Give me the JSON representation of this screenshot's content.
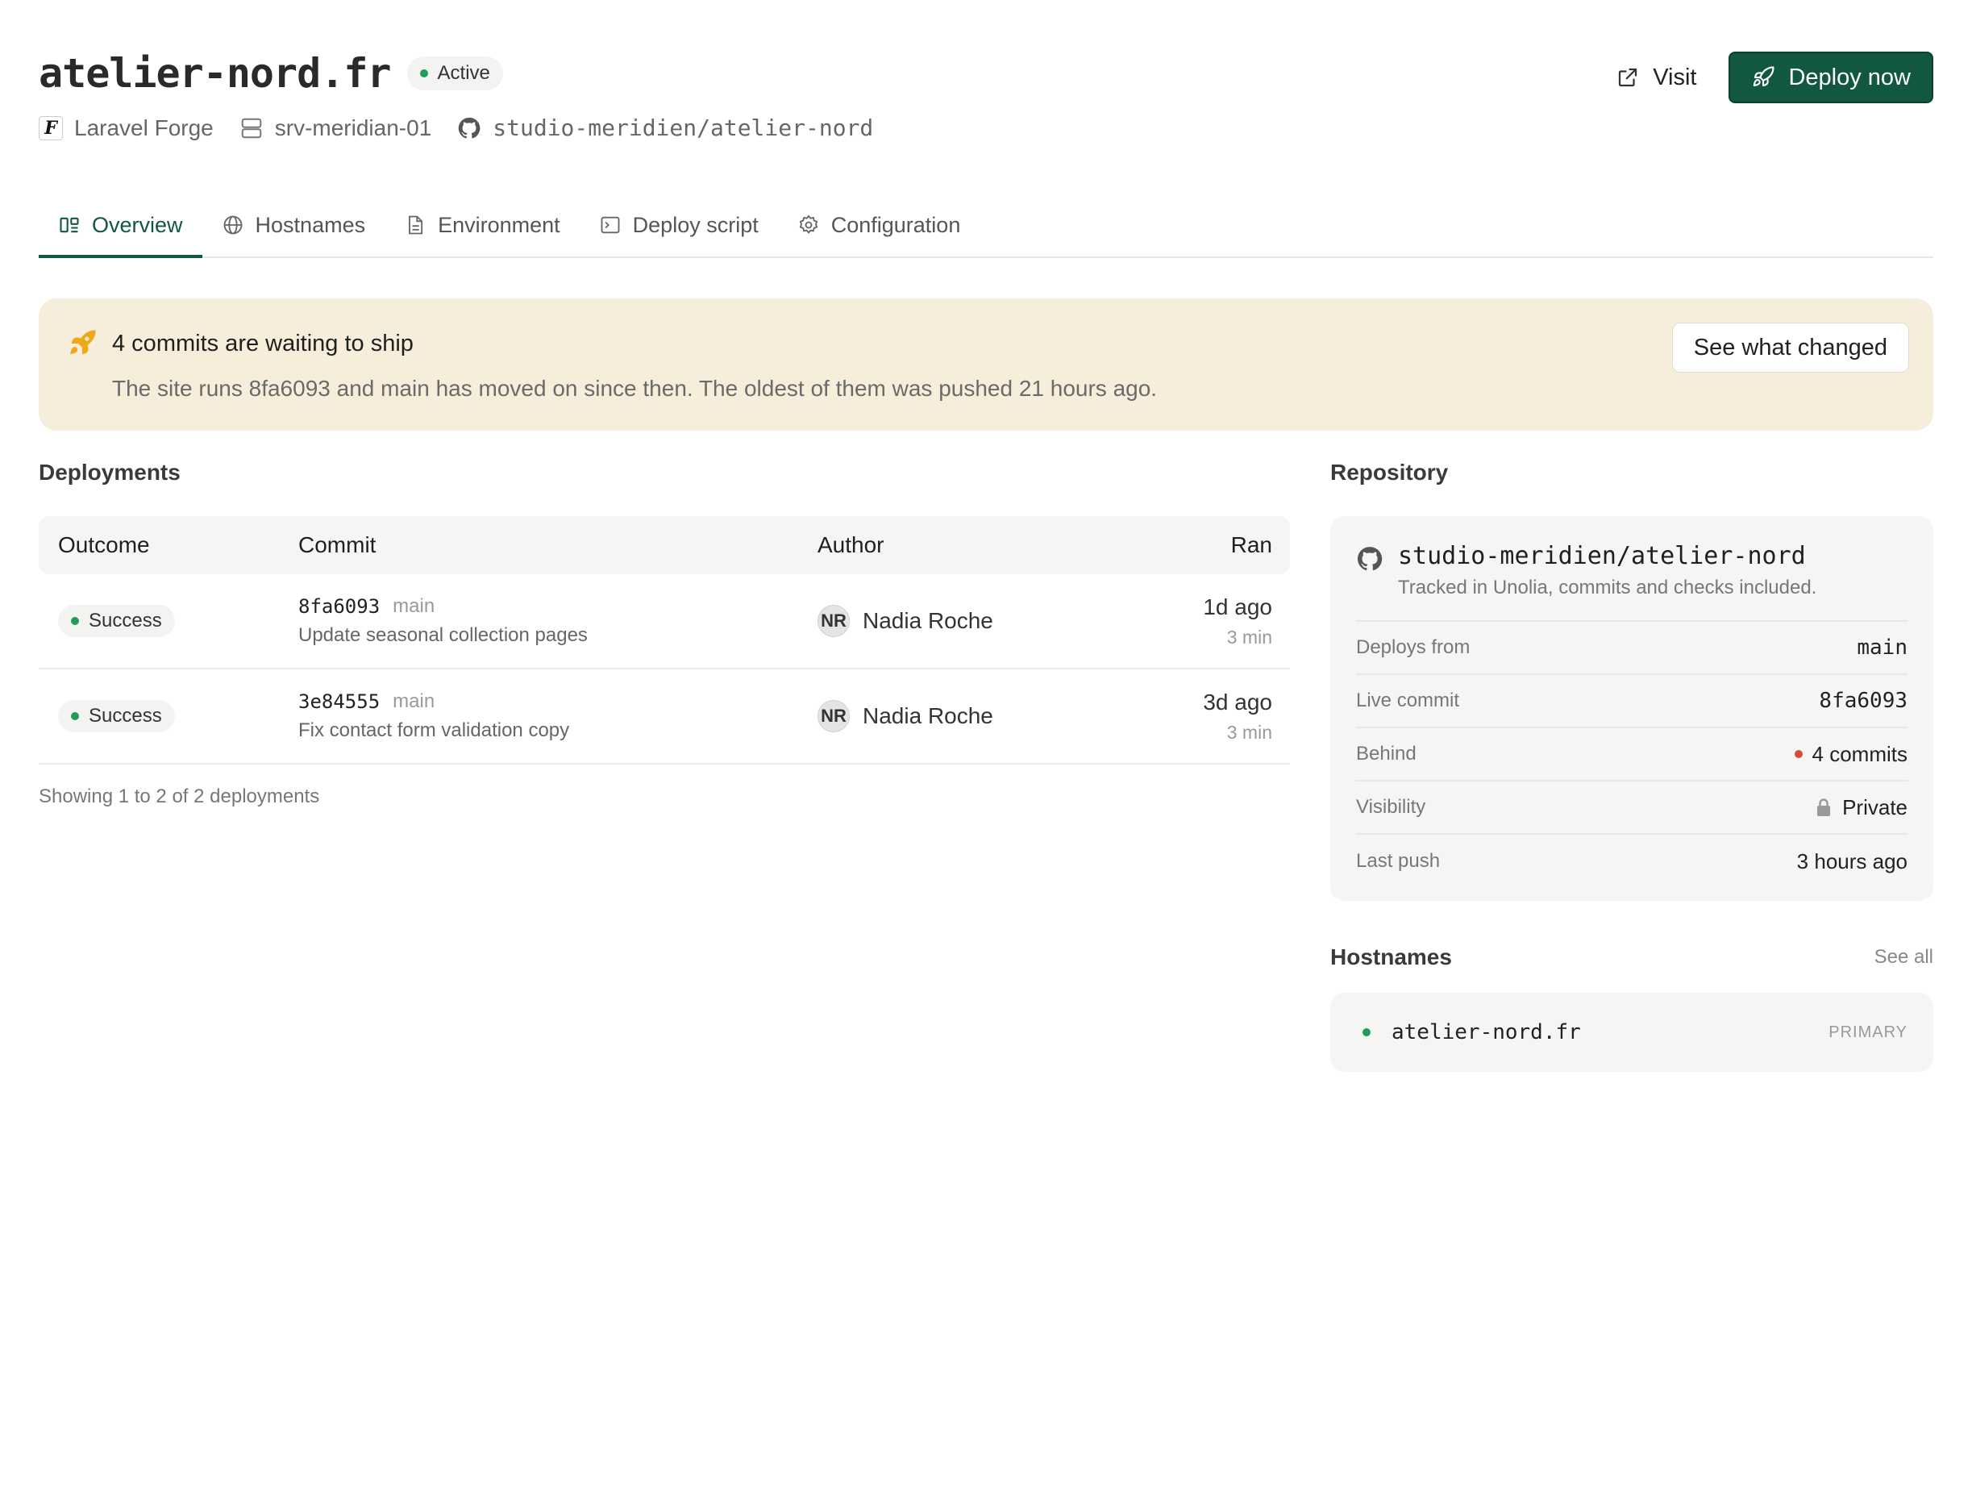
{
  "header": {
    "title": "atelier-nord.fr",
    "status": "Active",
    "provider": "Laravel Forge",
    "server": "srv-meridian-01",
    "repository": "studio-meridien/atelier-nord",
    "visit_label": "Visit",
    "deploy_label": "Deploy now"
  },
  "tabs": [
    {
      "label": "Overview",
      "icon": "overview-icon",
      "active": true
    },
    {
      "label": "Hostnames",
      "icon": "globe-icon"
    },
    {
      "label": "Environment",
      "icon": "file-icon"
    },
    {
      "label": "Deploy script",
      "icon": "terminal-icon"
    },
    {
      "label": "Configuration",
      "icon": "gear-icon"
    }
  ],
  "banner": {
    "title": "4 commits are waiting to ship",
    "text": "The site runs 8fa6093 and main has moved on since then. The oldest of them was pushed 21 hours ago.",
    "button": "See what changed"
  },
  "deployments": {
    "title": "Deployments",
    "columns": {
      "outcome": "Outcome",
      "commit": "Commit",
      "author": "Author",
      "ran": "Ran"
    },
    "rows": [
      {
        "outcome": "Success",
        "sha": "8fa6093",
        "branch": "main",
        "message": "Update seasonal collection pages",
        "initials": "NR",
        "author": "Nadia Roche",
        "ran": "1d ago",
        "duration": "3 min"
      },
      {
        "outcome": "Success",
        "sha": "3e84555",
        "branch": "main",
        "message": "Fix contact form validation copy",
        "initials": "NR",
        "author": "Nadia Roche",
        "ran": "3d ago",
        "duration": "3 min"
      }
    ],
    "footer": "Showing 1 to 2 of 2 deployments"
  },
  "repository": {
    "title": "Repository",
    "name": "studio-meridien/atelier-nord",
    "subtitle": "Tracked in Unolia, commits and checks included.",
    "details": {
      "deploys_from_label": "Deploys from",
      "deploys_from": "main",
      "live_commit_label": "Live commit",
      "live_commit": "8fa6093",
      "behind_label": "Behind",
      "behind": "4 commits",
      "visibility_label": "Visibility",
      "visibility": "Private",
      "last_push_label": "Last push",
      "last_push": "3 hours ago"
    }
  },
  "hostnames": {
    "title": "Hostnames",
    "see_all": "See all",
    "items": [
      {
        "name": "atelier-nord.fr",
        "tag": "PRIMARY"
      }
    ]
  },
  "colors": {
    "accent": "#12573f",
    "success": "#1f9d57",
    "warning_bg": "#f6eedb",
    "alert": "#d64b3d",
    "rocket": "#f0a719"
  }
}
